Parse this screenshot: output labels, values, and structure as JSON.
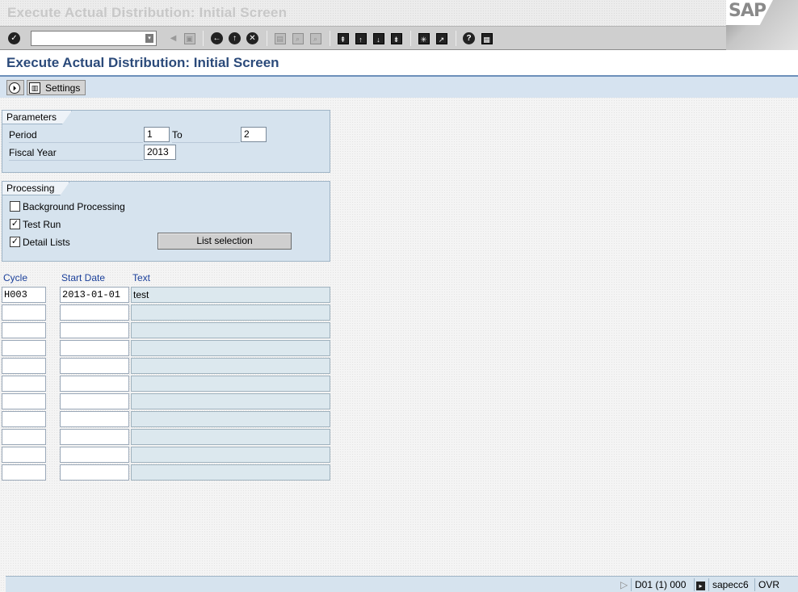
{
  "window": {
    "title": "Execute Actual Distribution: Initial Screen",
    "logo_text": "SAP"
  },
  "toolbar": {
    "command_field_value": "",
    "icons": [
      "enter-icon",
      "back-icon",
      "exit-icon",
      "cancel-icon",
      "save-icon",
      "print-icon",
      "find-icon",
      "find-next-icon",
      "first-page-icon",
      "previous-page-icon",
      "next-page-icon",
      "last-page-icon",
      "create-session-icon",
      "shortcut-icon",
      "help-icon",
      "customize-layout-icon"
    ]
  },
  "screen": {
    "title": "Execute Actual Distribution: Initial Screen"
  },
  "app_toolbar": {
    "execute_icon": "execute-icon",
    "settings_label": "Settings"
  },
  "parameters": {
    "title": "Parameters",
    "period_label": "Period",
    "period_from": "1",
    "to_label": "To",
    "period_to": "2",
    "fiscal_year_label": "Fiscal Year",
    "fiscal_year": "2013"
  },
  "processing": {
    "title": "Processing",
    "background_label": "Background Processing",
    "background_checked": false,
    "test_run_label": "Test Run",
    "test_run_checked": true,
    "detail_lists_label": "Detail Lists",
    "detail_lists_checked": true,
    "list_selection_label": "List selection"
  },
  "cycles_table": {
    "columns": [
      "Cycle",
      "Start Date",
      "Text"
    ],
    "rows": [
      {
        "cycle": "H003",
        "start_date": "2013-01-01",
        "text": "test"
      },
      {
        "cycle": "",
        "start_date": "",
        "text": ""
      },
      {
        "cycle": "",
        "start_date": "",
        "text": ""
      },
      {
        "cycle": "",
        "start_date": "",
        "text": ""
      },
      {
        "cycle": "",
        "start_date": "",
        "text": ""
      },
      {
        "cycle": "",
        "start_date": "",
        "text": ""
      },
      {
        "cycle": "",
        "start_date": "",
        "text": ""
      },
      {
        "cycle": "",
        "start_date": "",
        "text": ""
      },
      {
        "cycle": "",
        "start_date": "",
        "text": ""
      },
      {
        "cycle": "",
        "start_date": "",
        "text": ""
      },
      {
        "cycle": "",
        "start_date": "",
        "text": ""
      }
    ]
  },
  "statusbar": {
    "system": "D01 (1) 000",
    "server": "sapecc6",
    "mode": "OVR"
  }
}
